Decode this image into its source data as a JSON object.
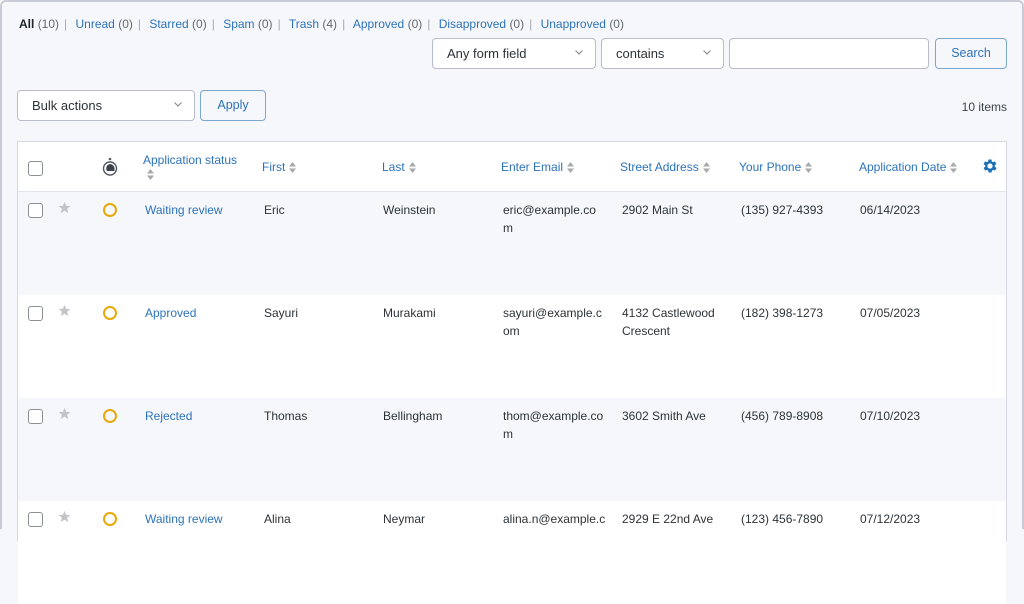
{
  "filters": [
    {
      "label": "All",
      "count": "(10)",
      "current": true
    },
    {
      "label": "Unread",
      "count": "(0)"
    },
    {
      "label": "Starred",
      "count": "(0)"
    },
    {
      "label": "Spam",
      "count": "(0)"
    },
    {
      "label": "Trash",
      "count": "(4)"
    },
    {
      "label": "Approved",
      "count": "(0)"
    },
    {
      "label": "Disapproved",
      "count": "(0)"
    },
    {
      "label": "Unapproved",
      "count": "(0)"
    }
  ],
  "search": {
    "field_select": "Any form field",
    "operator_select": "contains",
    "query_value": "",
    "button": "Search"
  },
  "bulk": {
    "select": "Bulk actions",
    "apply": "Apply"
  },
  "items_count": "10 items",
  "table": {
    "columns": [
      "Application status",
      "First",
      "Last",
      "Enter Email",
      "Street Address",
      "Your Phone",
      "Application Date"
    ],
    "rows": [
      {
        "status": "Waiting review",
        "first": "Eric",
        "last": "Weinstein",
        "email_1": "eric@example.co",
        "email_2": "m",
        "address_1": "2902 Main St",
        "address_2": "",
        "phone": "(135) 927-4393",
        "date": "06/14/2023"
      },
      {
        "status": "Approved",
        "first": "Sayuri",
        "last": "Murakami",
        "email_1": "sayuri@example.c",
        "email_2": "om",
        "address_1": "4132 Castlewood",
        "address_2": "Crescent",
        "phone": "(182) 398-1273",
        "date": "07/05/2023"
      },
      {
        "status": "Rejected",
        "first": "Thomas",
        "last": "Bellingham",
        "email_1": "thom@example.co",
        "email_2": "m",
        "address_1": "3602 Smith Ave",
        "address_2": "",
        "phone": "(456) 789-8908",
        "date": "07/10/2023"
      },
      {
        "status": "Waiting review",
        "first": "Alina",
        "last": "Neymar",
        "email_1": "alina.n@example.c",
        "email_2": "",
        "address_1": "2929 E 22nd Ave",
        "address_2": "",
        "phone": "(123) 456-7890",
        "date": "07/12/2023"
      }
    ]
  },
  "colors": {
    "link": "#2d73b9",
    "status_ring": "#e8a80c",
    "gear": "#1e6fb8"
  }
}
